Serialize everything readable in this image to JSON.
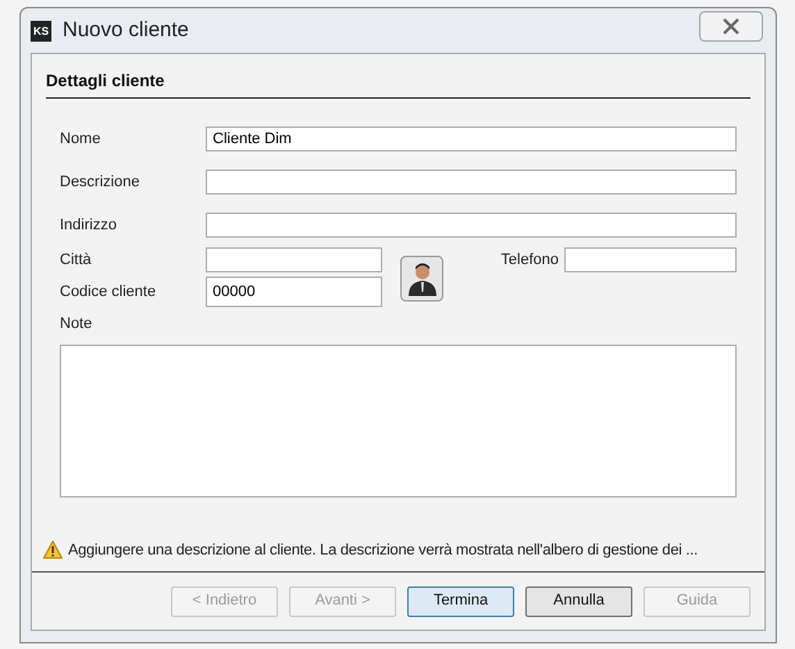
{
  "window": {
    "title": "Nuovo cliente",
    "app_icon": "KS"
  },
  "section": {
    "title": "Dettagli cliente"
  },
  "fields": [
    {
      "label": "Nome",
      "value": "Cliente Dim"
    },
    {
      "label": "Descrizione"
    },
    {
      "label": "Indirizzo"
    }
  ],
  "city": {
    "label": "Città"
  },
  "phone": {
    "label": "Telefono"
  },
  "code": {
    "label": "Codice cliente",
    "value": "00000"
  },
  "notes": {
    "label": "Note"
  },
  "warning": "Aggiungere una descrizione al cliente. La descrizione verrà mostrata nell'albero di gestione dei ...",
  "buttons": [
    {
      "label": "< Indietro",
      "disabled": true,
      "default": false
    },
    {
      "label": "Avanti >",
      "disabled": true,
      "default": false
    },
    {
      "label": "Termina",
      "disabled": false,
      "default": true
    },
    {
      "label": "Annulla",
      "disabled": false,
      "default": false
    },
    {
      "label": "Guida",
      "disabled": true,
      "default": false
    }
  ]
}
